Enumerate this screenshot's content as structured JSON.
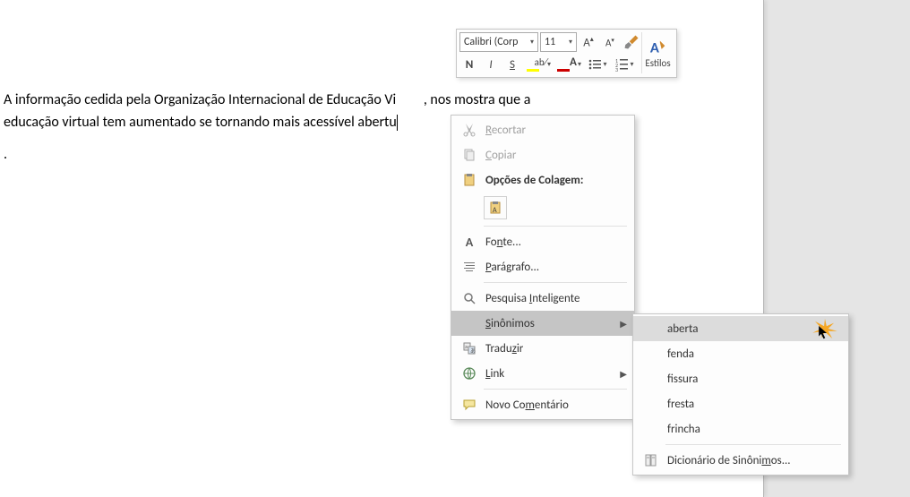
{
  "document": {
    "line1": "A informação cedida pela Organização Internacional de Educação Vi",
    "line2_suffix": ", nos mostra que a",
    "line3": "educação virtual tem aumentado se tornando mais acessível abertu",
    "periodLine": "."
  },
  "miniToolbar": {
    "fontName": "Calibri (Corp",
    "fontSize": "11",
    "stylesLabel": "Estilos"
  },
  "contextMenu": {
    "cut": "Recortar",
    "copy": "Copiar",
    "pasteOptionsLabel": "Opções de Colagem:",
    "font": "Fonte...",
    "paragraph": "Parágrafo...",
    "smartLookup": "Pesquisa Inteligente",
    "synonyms": "Sinônimos",
    "translate": "Traduzir",
    "link": "Link",
    "newComment": "Novo Comentário"
  },
  "synonymsSubmenu": {
    "items": [
      "aberta",
      "fenda",
      "fissura",
      "fresta",
      "frincha"
    ],
    "thesaurus": "Dicionário de Sinônimos..."
  },
  "colors": {
    "highlight": "#ffff00",
    "fontColor": "#cc0000"
  }
}
